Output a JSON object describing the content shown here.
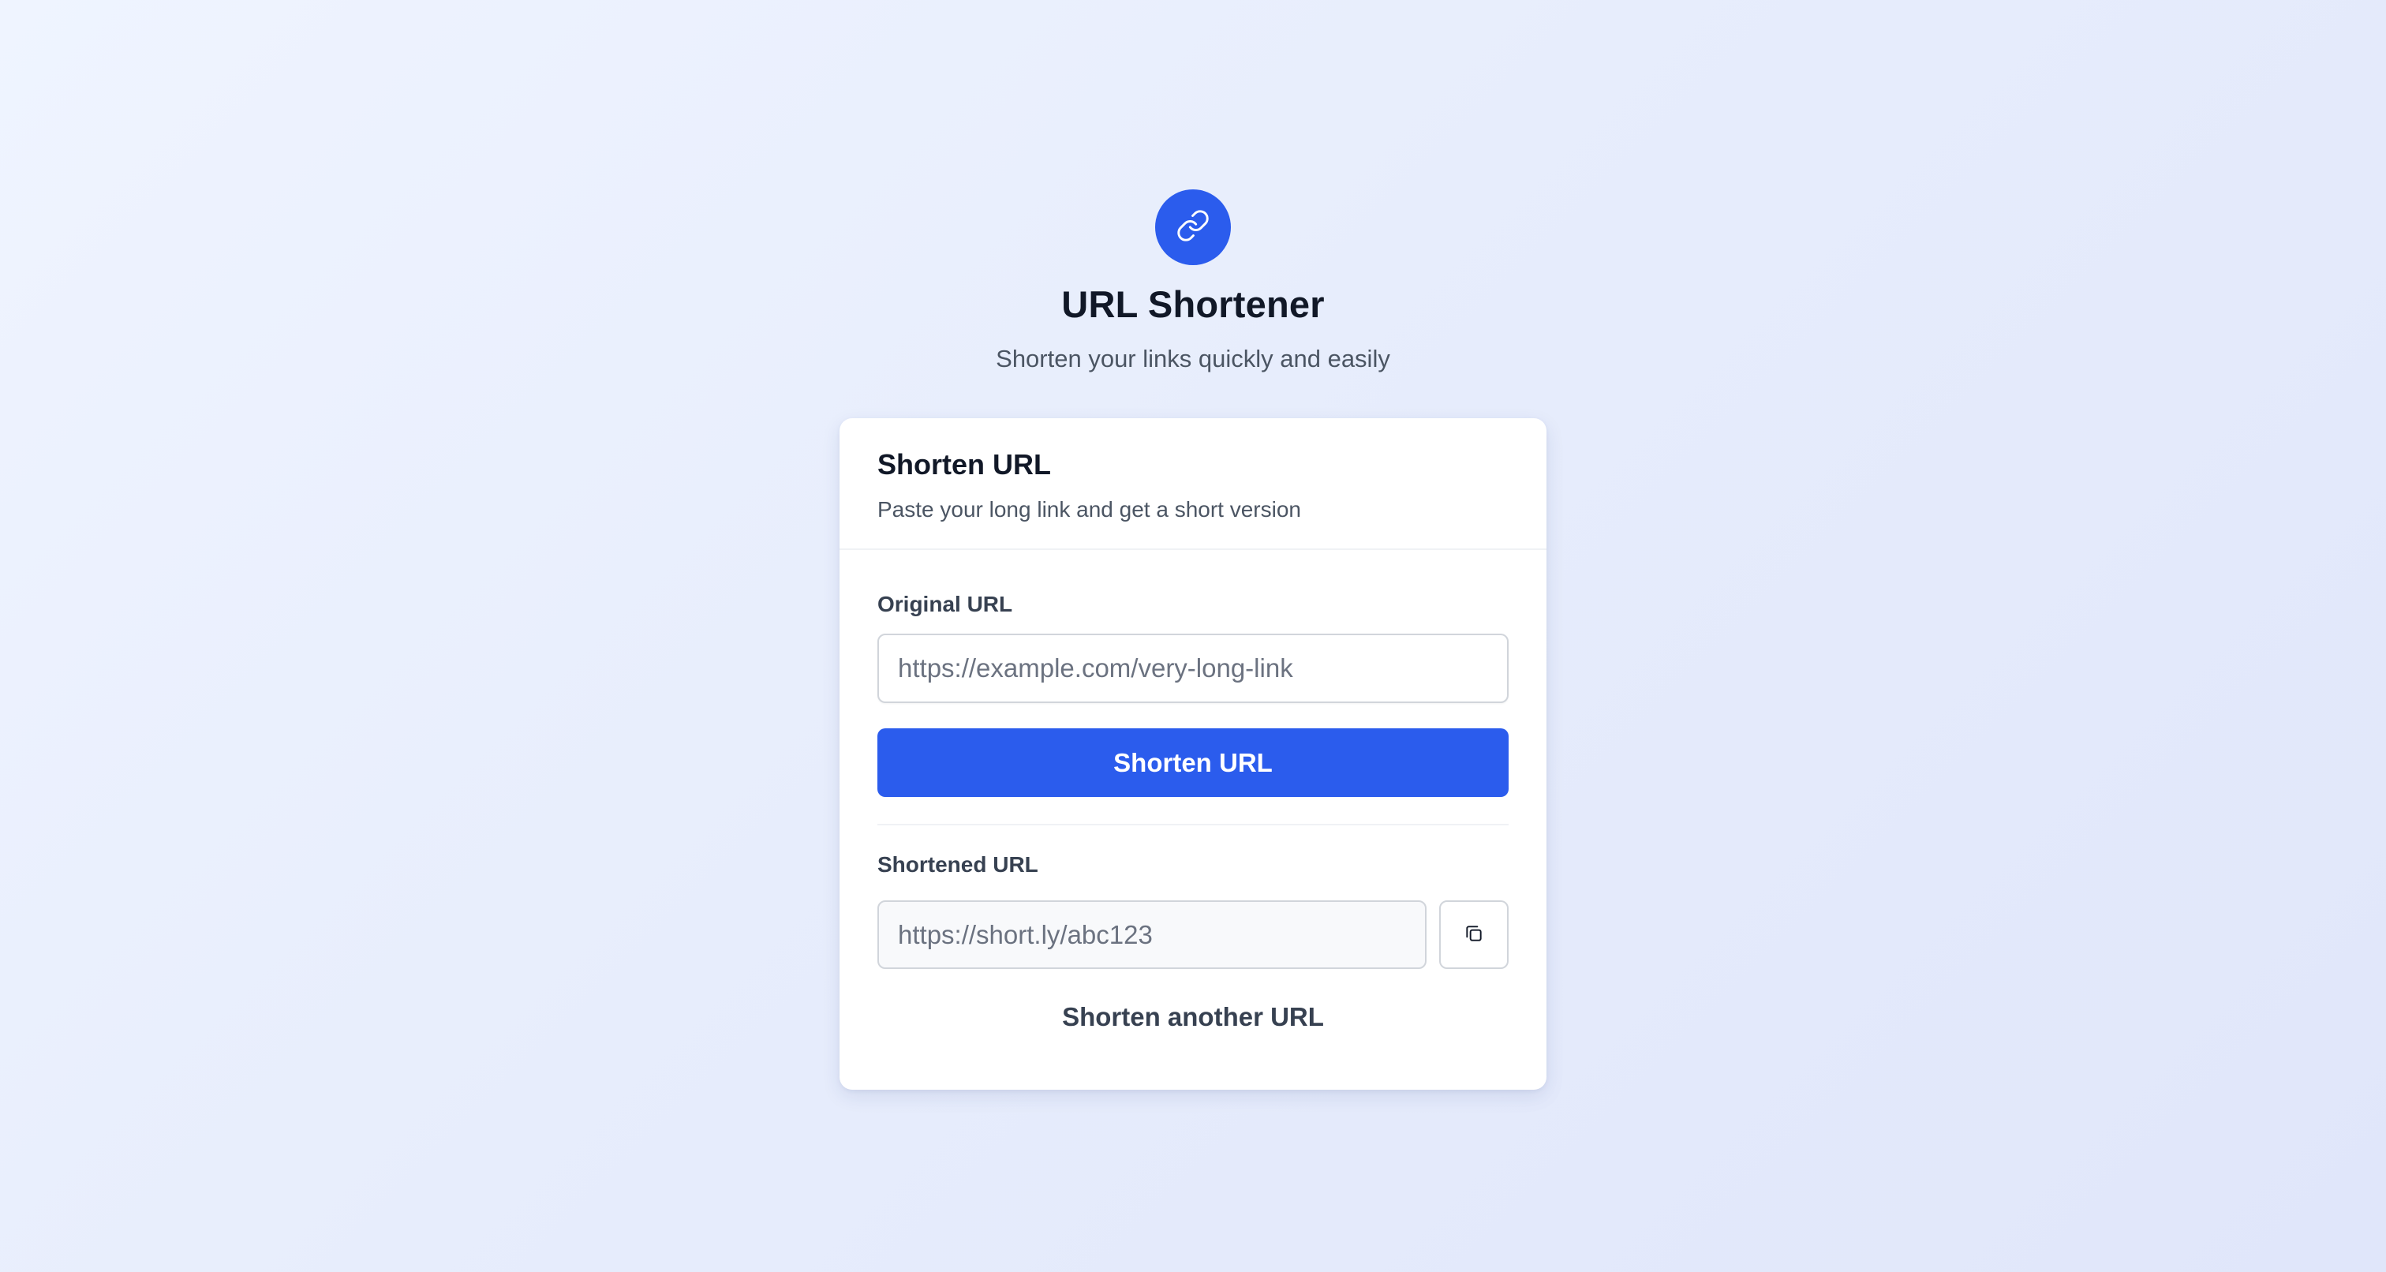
{
  "app": {
    "title": "URL Shortener",
    "subtitle": "Shorten your links quickly and easily",
    "logo_icon": "link-icon"
  },
  "card": {
    "title": "Shorten URL",
    "description": "Paste your long link and get a short version"
  },
  "form": {
    "original_label": "Original URL",
    "original_placeholder": "https://example.com/very-long-link",
    "original_value": "",
    "shorten_button_label": "Shorten URL"
  },
  "result": {
    "shortened_label": "Shortened URL",
    "shortened_placeholder": "https://short.ly/abc123",
    "shortened_value": "",
    "copy_icon": "copy-icon",
    "another_label": "Shorten another URL"
  },
  "colors": {
    "accent": "#2b5ced",
    "background": "#e7edfc",
    "card": "#ffffff",
    "text": "#111827",
    "muted_text": "#4b5563"
  }
}
